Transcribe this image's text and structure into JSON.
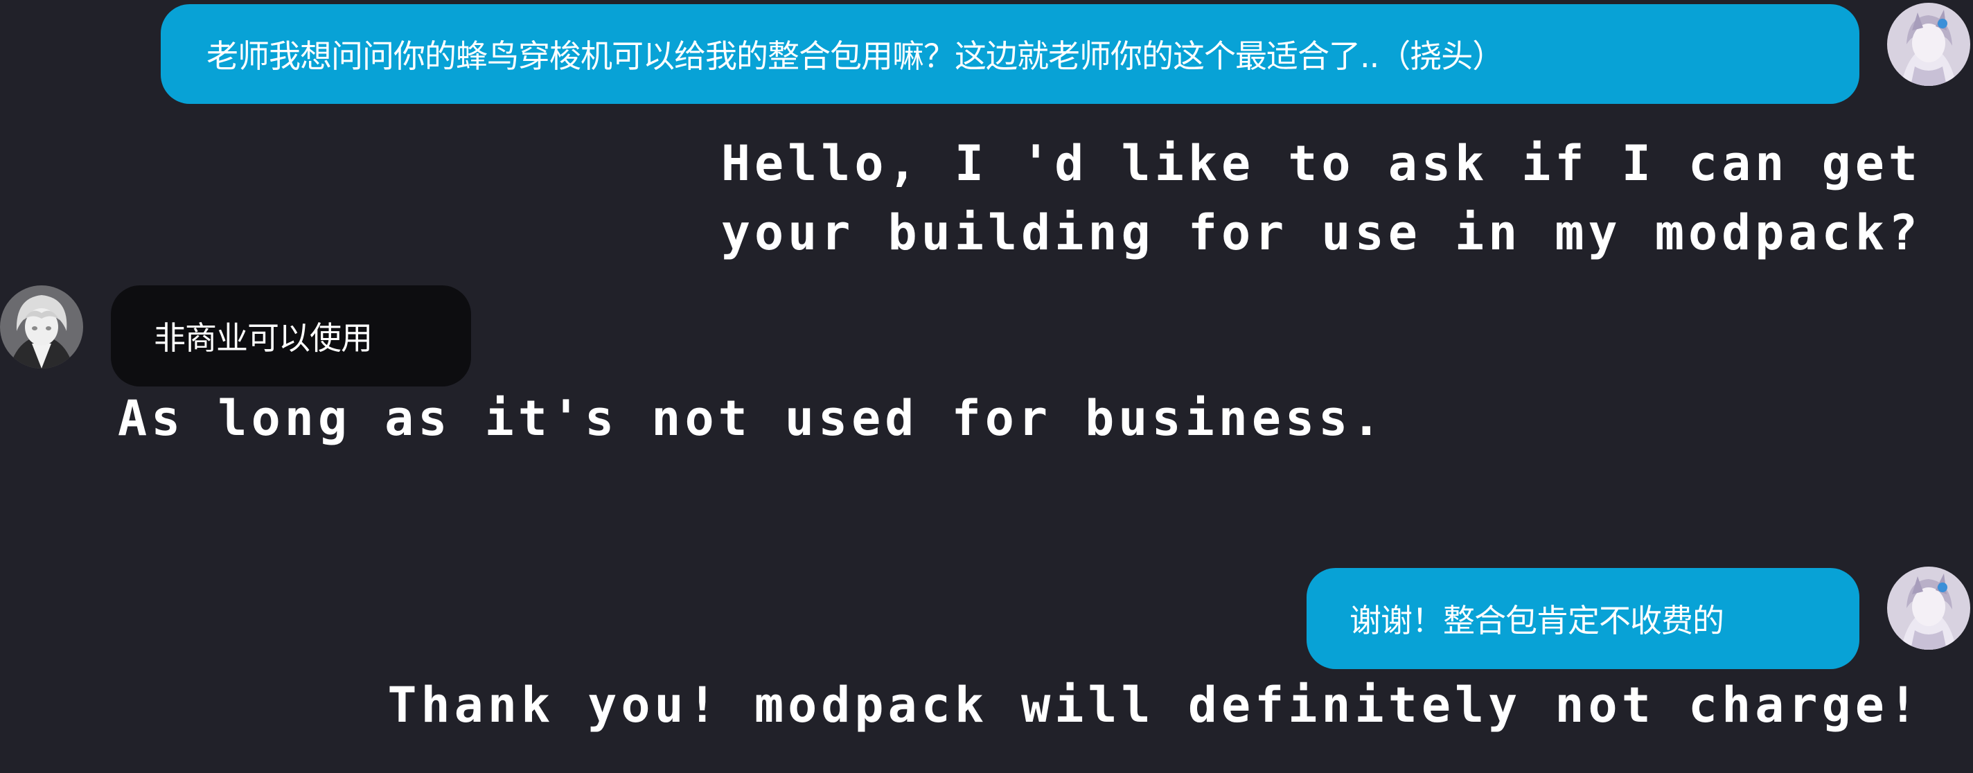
{
  "messages": [
    {
      "sender": "self",
      "text": "老师我想问问你的蜂鸟穿梭机可以给我的整合包用嘛？这边就老师你的这个最适合了..（挠头）",
      "translation_lines": [
        "Hello, I 'd like to ask if I can get",
        "your building for use in my modpack?"
      ]
    },
    {
      "sender": "other",
      "text": "非商业可以使用",
      "translation_lines": [
        "As long as it's not used for business."
      ]
    },
    {
      "sender": "self",
      "text": "谢谢！整合包肯定不收费的",
      "translation_lines": [
        "Thank you! modpack will definitely not charge!"
      ]
    }
  ],
  "colors": {
    "background": "#212129",
    "outgoing_bubble": "#08a2d6",
    "incoming_bubble": "#0d0d10",
    "text": "#ffffff"
  },
  "icons": {
    "self_avatar": "anime-character-avatar-icon",
    "other_avatar": "anime-character-avatar-icon"
  }
}
